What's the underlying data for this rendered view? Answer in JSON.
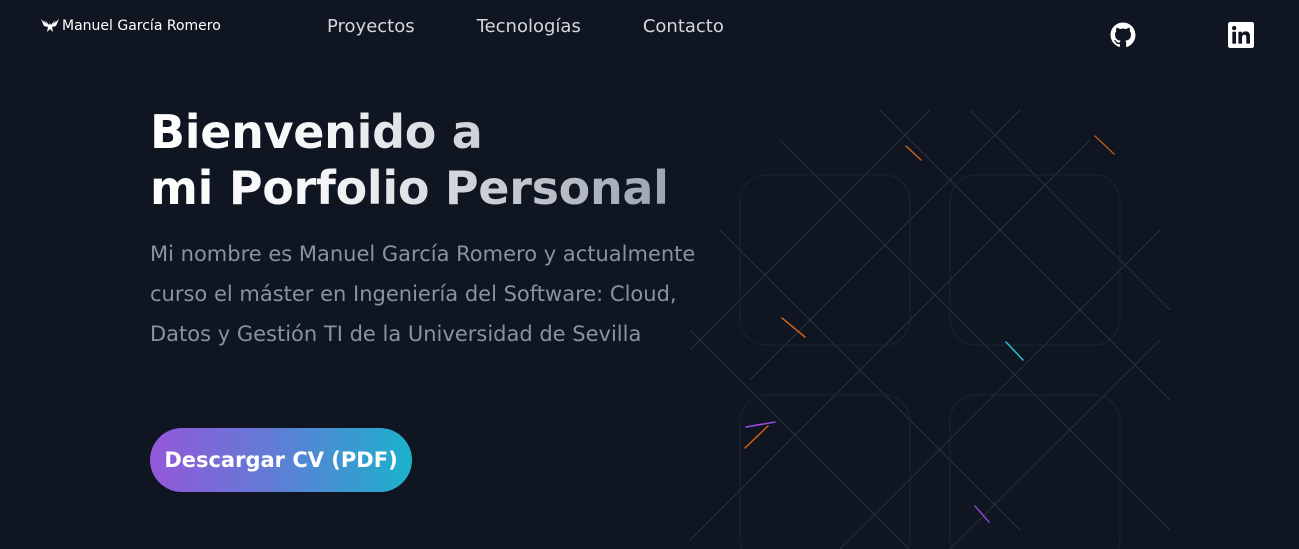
{
  "header": {
    "logo_icon": "eagle-icon",
    "site_name": "Manuel García Romero",
    "nav": [
      {
        "label": "Proyectos"
      },
      {
        "label": "Tecnologías"
      },
      {
        "label": "Contacto"
      }
    ],
    "social": [
      {
        "icon": "github-icon"
      },
      {
        "icon": "linkedin-icon"
      }
    ]
  },
  "hero": {
    "title_line1": "Bienvenido a",
    "title_line2": "mi Porfolio Personal",
    "description": "Mi nombre es Manuel García Romero y actualmente curso el máster en Ingeniería del Software: Cloud, Datos y Gestión TI de la Universidad de Sevilla",
    "cv_button": "Descargar CV (PDF)"
  },
  "colors": {
    "background": "#101621",
    "nav_text": "#d4d7dc",
    "body_text": "#8c929b",
    "button_gradient": [
      "#9457d9",
      "#5d7fd6",
      "#1bb1cb"
    ],
    "grid_lines": "#2a313d",
    "accent_orange": "#f97316",
    "accent_cyan": "#22d3ee",
    "accent_purple": "#a855f7"
  }
}
